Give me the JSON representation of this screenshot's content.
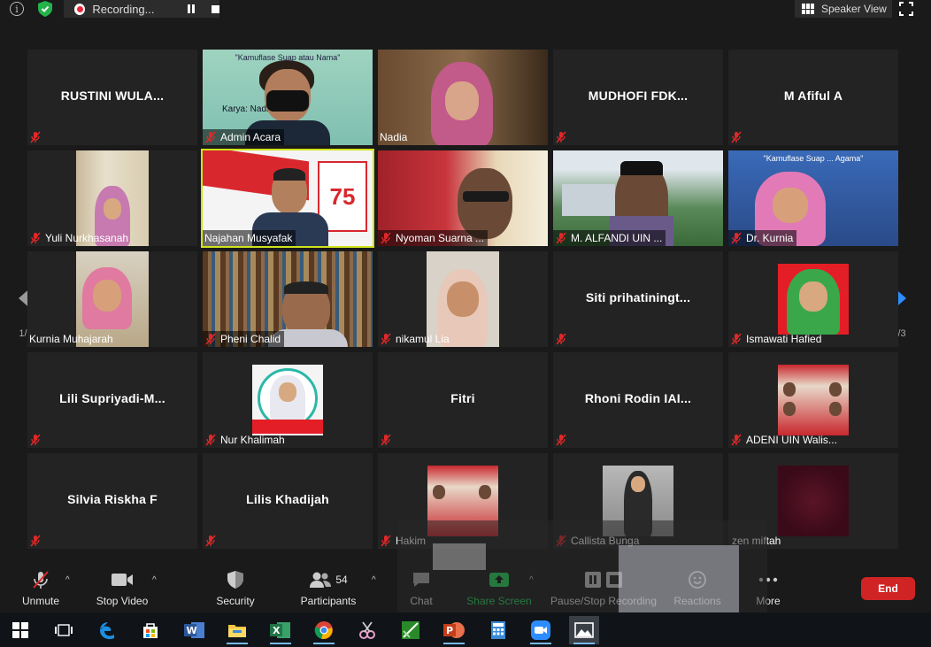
{
  "topbar": {
    "recording_label": "Recording...",
    "speaker_view_label": "Speaker View"
  },
  "pagination": {
    "left": "1/3",
    "right": "1/3"
  },
  "participants": [
    {
      "name": "RUSTINI WULA...",
      "label": "",
      "video": false
    },
    {
      "name": "",
      "label": "Admin Acara",
      "video": true
    },
    {
      "name": "",
      "label": "Nadia",
      "video": true
    },
    {
      "name": "MUDHOFI FDK...",
      "label": "",
      "video": false
    },
    {
      "name": "M Afiful A",
      "label": "",
      "video": false
    },
    {
      "name": "",
      "label": "Yuli Nurkhasanah",
      "video": true
    },
    {
      "name": "",
      "label": "Najahan Musyafak",
      "video": true,
      "active": true
    },
    {
      "name": "",
      "label": "Nyoman Suarna ...",
      "video": true
    },
    {
      "name": "",
      "label": "M. ALFANDI UIN ...",
      "video": true
    },
    {
      "name": "",
      "label": "Dr. Kurnia",
      "video": true
    },
    {
      "name": "",
      "label": "Kurnia Muhajarah",
      "video": true
    },
    {
      "name": "",
      "label": "Pheni Chalid",
      "video": true
    },
    {
      "name": "",
      "label": "nikamul Lia",
      "video": true
    },
    {
      "name": "Siti prihatiningt...",
      "label": "",
      "video": false
    },
    {
      "name": "",
      "label": "Ismawati Hafied",
      "video": true
    },
    {
      "name": "Lili Supriyadi-M...",
      "label": "",
      "video": false
    },
    {
      "name": "",
      "label": "Nur Khalimah",
      "video": true
    },
    {
      "name": "Fitri",
      "label": "",
      "video": false
    },
    {
      "name": "Rhoni Rodin IAI...",
      "label": "",
      "video": false
    },
    {
      "name": "",
      "label": "ADENI UIN Walis...",
      "video": true
    },
    {
      "name": "Silvia Riskha F",
      "label": "",
      "video": false
    },
    {
      "name": "Lilis Khadijah",
      "label": "",
      "video": false
    },
    {
      "name": "",
      "label": "Hakim",
      "video": true
    },
    {
      "name": "",
      "label": "Callista Bunga",
      "video": true
    },
    {
      "name": "",
      "label": "zen miftah",
      "video": true
    }
  ],
  "slide_text": {
    "top": "\"Kamuflase Suap atau Nama\"",
    "karya": "Karya: Nadia ... Ph.D",
    "kurnia_top": "\"Kamuflase Suap ... Agama\""
  },
  "toolbar": {
    "unmute": "Unmute",
    "stop_video": "Stop Video",
    "security": "Security",
    "participants": "Participants",
    "participant_count": "54",
    "chat": "Chat",
    "share_screen": "Share Screen",
    "pause_stop_recording": "Pause/Stop Recording",
    "reactions": "Reactions",
    "more": "More",
    "end": "End"
  },
  "colors": {
    "active_speaker_border": "#cfe31c",
    "share_green": "#23d959",
    "end_red": "#d02424",
    "mute_red": "#e02828",
    "nav_blue": "#2d8cff"
  },
  "taskbar_icons": [
    "windows-start-icon",
    "task-view-icon",
    "edge-icon",
    "store-icon",
    "word-icon",
    "file-explorer-icon",
    "excel-icon",
    "chrome-icon",
    "snipping-icon",
    "picture-icon",
    "powerpoint-icon",
    "calculator-icon",
    "zoom-icon",
    "photos-icon"
  ]
}
